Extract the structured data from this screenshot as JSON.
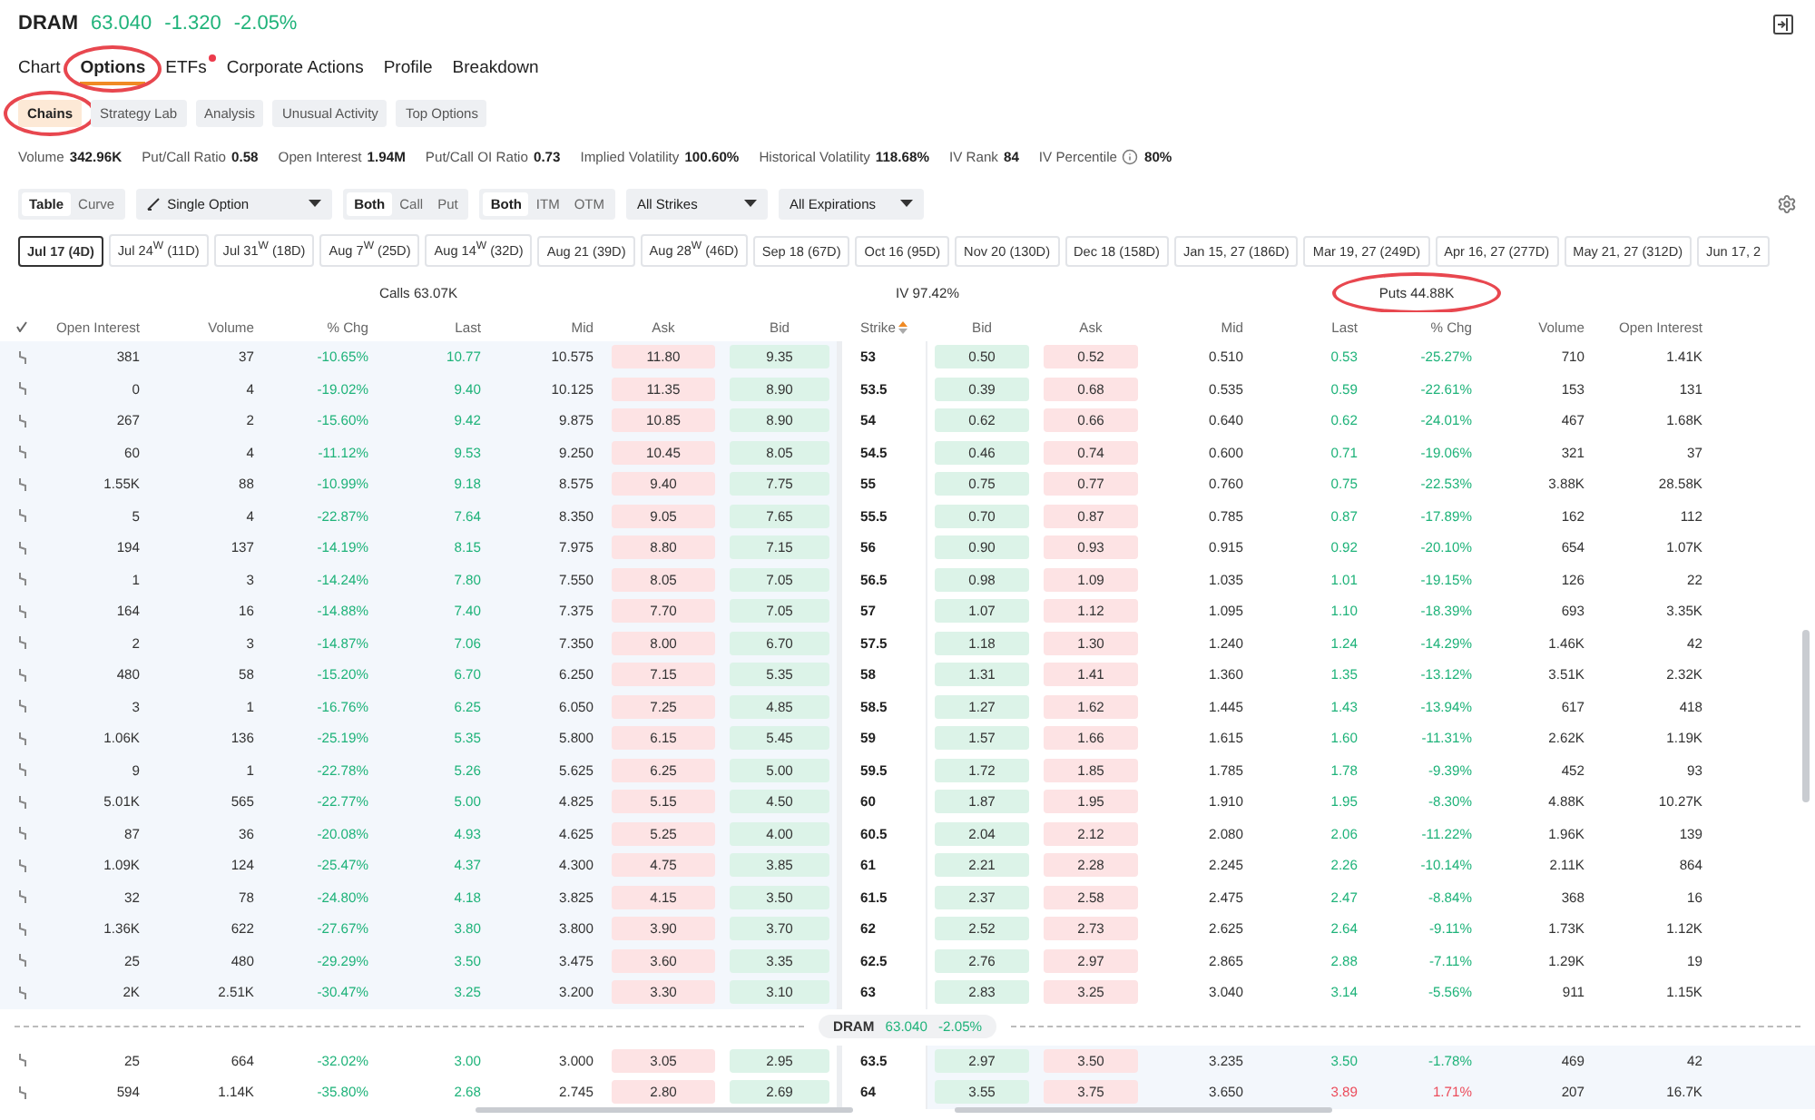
{
  "quote": {
    "symbol": "DRAM",
    "price": "63.040",
    "change": "-1.320",
    "percent": "-2.05%",
    "up": false
  },
  "tabs": [
    {
      "label": "Chart",
      "selected": false
    },
    {
      "label": "Options",
      "selected": true,
      "circled": true
    },
    {
      "label": "ETFs",
      "selected": false,
      "badge": true
    },
    {
      "label": "Corporate Actions",
      "selected": false
    },
    {
      "label": "Profile",
      "selected": false
    },
    {
      "label": "Breakdown",
      "selected": false
    }
  ],
  "subtabs": [
    {
      "label": "Chains",
      "selected": true,
      "circled": true
    },
    {
      "label": "Strategy Lab",
      "selected": false
    },
    {
      "label": "Analysis",
      "selected": false
    },
    {
      "label": "Unusual Activity",
      "selected": false
    },
    {
      "label": "Top Options",
      "selected": false
    }
  ],
  "stats": [
    {
      "label": "Volume",
      "value": "342.96K"
    },
    {
      "label": "Put/Call Ratio",
      "value": "0.58"
    },
    {
      "label": "Open Interest",
      "value": "1.94M"
    },
    {
      "label": "Put/Call OI Ratio",
      "value": "0.73"
    },
    {
      "label": "Implied Volatility",
      "value": "100.60%"
    },
    {
      "label": "Historical Volatility",
      "value": "118.68%"
    },
    {
      "label": "IV Rank",
      "value": "84"
    },
    {
      "label": "IV Percentile",
      "value": "80%",
      "info": true
    }
  ],
  "toolbar": {
    "view": [
      {
        "label": "Table",
        "selected": true
      },
      {
        "label": "Curve",
        "selected": false
      }
    ],
    "strategy": "Single Option",
    "side": [
      {
        "label": "Both",
        "selected": true
      },
      {
        "label": "Call",
        "selected": false
      },
      {
        "label": "Put",
        "selected": false
      }
    ],
    "moneyness": [
      {
        "label": "Both",
        "selected": true
      },
      {
        "label": "ITM",
        "selected": false
      },
      {
        "label": "OTM",
        "selected": false
      }
    ],
    "strikes": "All Strikes",
    "expirations": "All Expirations"
  },
  "expirations": [
    {
      "label": "Jul 17 (4D)",
      "selected": true
    },
    {
      "label": "Jul 24$^{W}$ (11D)",
      "selected": false
    },
    {
      "label": "Jul 31$^{W}$ (18D)",
      "selected": false
    },
    {
      "label": "Aug 7$^{W}$ (25D)",
      "selected": false
    },
    {
      "label": "Aug 14$^{W}$ (32D)",
      "selected": false
    },
    {
      "label": "Aug 21 (39D)",
      "selected": false
    },
    {
      "label": "Aug 28$^{W}$ (46D)",
      "selected": false
    },
    {
      "label": "Sep 18 (67D)",
      "selected": false
    },
    {
      "label": "Oct 16 (95D)",
      "selected": false
    },
    {
      "label": "Nov 20 (130D)",
      "selected": false
    },
    {
      "label": "Dec 18 (158D)",
      "selected": false
    },
    {
      "label": "Jan 15, 27 (186D)",
      "selected": false
    },
    {
      "label": "Mar 19, 27 (249D)",
      "selected": false
    },
    {
      "label": "Apr 16, 27 (277D)",
      "selected": false
    },
    {
      "label": "May 21, 27 (312D)",
      "selected": false
    },
    {
      "label": "Jun 17, 2",
      "selected": false
    }
  ],
  "summary": {
    "calls": "Calls 63.07K",
    "iv": "IV 97.42%",
    "puts": "Puts 44.88K",
    "puts_circled": true
  },
  "table": {
    "call_columns": [
      "Open Interest",
      "Volume",
      "% Chg",
      "Last",
      "Mid",
      "Ask",
      "Bid"
    ],
    "strike_column": "Strike",
    "put_columns": [
      "Bid",
      "Ask",
      "Mid",
      "Last",
      "% Chg",
      "Volume",
      "Open Interest"
    ],
    "rows": [
      {
        "kind": "option",
        "strike": "53",
        "calls_itm": true,
        "puts_itm": false,
        "call_up": false,
        "put_up": false,
        "call": [
          "381",
          "37",
          "-10.65%",
          "10.77",
          "10.575",
          "11.80",
          "9.35"
        ],
        "put": [
          "0.50",
          "0.52",
          "0.510",
          "0.53",
          "-25.27%",
          "710",
          "1.41K"
        ]
      },
      {
        "kind": "option",
        "strike": "53.5",
        "calls_itm": true,
        "puts_itm": false,
        "call_up": false,
        "put_up": false,
        "call": [
          "0",
          "4",
          "-19.02%",
          "9.40",
          "10.125",
          "11.35",
          "8.90"
        ],
        "put": [
          "0.39",
          "0.68",
          "0.535",
          "0.59",
          "-22.61%",
          "153",
          "131"
        ]
      },
      {
        "kind": "option",
        "strike": "54",
        "calls_itm": true,
        "puts_itm": false,
        "call_up": false,
        "put_up": false,
        "call": [
          "267",
          "2",
          "-15.60%",
          "9.42",
          "9.875",
          "10.85",
          "8.90"
        ],
        "put": [
          "0.62",
          "0.66",
          "0.640",
          "0.62",
          "-24.01%",
          "467",
          "1.68K"
        ]
      },
      {
        "kind": "option",
        "strike": "54.5",
        "calls_itm": true,
        "puts_itm": false,
        "call_up": false,
        "put_up": false,
        "call": [
          "60",
          "4",
          "-11.12%",
          "9.53",
          "9.250",
          "10.45",
          "8.05"
        ],
        "put": [
          "0.46",
          "0.74",
          "0.600",
          "0.71",
          "-19.06%",
          "321",
          "37"
        ]
      },
      {
        "kind": "option",
        "strike": "55",
        "calls_itm": true,
        "puts_itm": false,
        "call_up": false,
        "put_up": false,
        "call": [
          "1.55K",
          "88",
          "-10.99%",
          "9.18",
          "8.575",
          "9.40",
          "7.75"
        ],
        "put": [
          "0.75",
          "0.77",
          "0.760",
          "0.75",
          "-22.53%",
          "3.88K",
          "28.58K"
        ]
      },
      {
        "kind": "option",
        "strike": "55.5",
        "calls_itm": true,
        "puts_itm": false,
        "call_up": false,
        "put_up": false,
        "call": [
          "5",
          "4",
          "-22.87%",
          "7.64",
          "8.350",
          "9.05",
          "7.65"
        ],
        "put": [
          "0.70",
          "0.87",
          "0.785",
          "0.87",
          "-17.89%",
          "162",
          "112"
        ]
      },
      {
        "kind": "option",
        "strike": "56",
        "calls_itm": true,
        "puts_itm": false,
        "call_up": false,
        "put_up": false,
        "call": [
          "194",
          "137",
          "-14.19%",
          "8.15",
          "7.975",
          "8.80",
          "7.15"
        ],
        "put": [
          "0.90",
          "0.93",
          "0.915",
          "0.92",
          "-20.10%",
          "654",
          "1.07K"
        ]
      },
      {
        "kind": "option",
        "strike": "56.5",
        "calls_itm": true,
        "puts_itm": false,
        "call_up": false,
        "put_up": false,
        "call": [
          "1",
          "3",
          "-14.24%",
          "7.80",
          "7.550",
          "8.05",
          "7.05"
        ],
        "put": [
          "0.98",
          "1.09",
          "1.035",
          "1.01",
          "-19.15%",
          "126",
          "22"
        ]
      },
      {
        "kind": "option",
        "strike": "57",
        "calls_itm": true,
        "puts_itm": false,
        "call_up": false,
        "put_up": false,
        "call": [
          "164",
          "16",
          "-14.88%",
          "7.40",
          "7.375",
          "7.70",
          "7.05"
        ],
        "put": [
          "1.07",
          "1.12",
          "1.095",
          "1.10",
          "-18.39%",
          "693",
          "3.35K"
        ]
      },
      {
        "kind": "option",
        "strike": "57.5",
        "calls_itm": true,
        "puts_itm": false,
        "call_up": false,
        "put_up": false,
        "call": [
          "2",
          "3",
          "-14.87%",
          "7.06",
          "7.350",
          "8.00",
          "6.70"
        ],
        "put": [
          "1.18",
          "1.30",
          "1.240",
          "1.24",
          "-14.29%",
          "1.46K",
          "42"
        ]
      },
      {
        "kind": "option",
        "strike": "58",
        "calls_itm": true,
        "puts_itm": false,
        "call_up": false,
        "put_up": false,
        "call": [
          "480",
          "58",
          "-15.20%",
          "6.70",
          "6.250",
          "7.15",
          "5.35"
        ],
        "put": [
          "1.31",
          "1.41",
          "1.360",
          "1.35",
          "-13.12%",
          "3.51K",
          "2.32K"
        ]
      },
      {
        "kind": "option",
        "strike": "58.5",
        "calls_itm": true,
        "puts_itm": false,
        "call_up": false,
        "put_up": false,
        "call": [
          "3",
          "1",
          "-16.76%",
          "6.25",
          "6.050",
          "7.25",
          "4.85"
        ],
        "put": [
          "1.27",
          "1.62",
          "1.445",
          "1.43",
          "-13.94%",
          "617",
          "418"
        ]
      },
      {
        "kind": "option",
        "strike": "59",
        "calls_itm": true,
        "puts_itm": false,
        "call_up": false,
        "put_up": false,
        "call": [
          "1.06K",
          "136",
          "-25.19%",
          "5.35",
          "5.800",
          "6.15",
          "5.45"
        ],
        "put": [
          "1.57",
          "1.66",
          "1.615",
          "1.60",
          "-11.31%",
          "2.62K",
          "1.19K"
        ]
      },
      {
        "kind": "option",
        "strike": "59.5",
        "calls_itm": true,
        "puts_itm": false,
        "call_up": false,
        "put_up": false,
        "call": [
          "9",
          "1",
          "-22.78%",
          "5.26",
          "5.625",
          "6.25",
          "5.00"
        ],
        "put": [
          "1.72",
          "1.85",
          "1.785",
          "1.78",
          "-9.39%",
          "452",
          "93"
        ]
      },
      {
        "kind": "option",
        "strike": "60",
        "calls_itm": true,
        "puts_itm": false,
        "call_up": false,
        "put_up": false,
        "call": [
          "5.01K",
          "565",
          "-22.77%",
          "5.00",
          "4.825",
          "5.15",
          "4.50"
        ],
        "put": [
          "1.87",
          "1.95",
          "1.910",
          "1.95",
          "-8.30%",
          "4.88K",
          "10.27K"
        ]
      },
      {
        "kind": "option",
        "strike": "60.5",
        "calls_itm": true,
        "puts_itm": false,
        "call_up": false,
        "put_up": false,
        "call": [
          "87",
          "36",
          "-20.08%",
          "4.93",
          "4.625",
          "5.25",
          "4.00"
        ],
        "put": [
          "2.04",
          "2.12",
          "2.080",
          "2.06",
          "-11.22%",
          "1.96K",
          "139"
        ]
      },
      {
        "kind": "option",
        "strike": "61",
        "calls_itm": true,
        "puts_itm": false,
        "call_up": false,
        "put_up": false,
        "call": [
          "1.09K",
          "124",
          "-25.47%",
          "4.37",
          "4.300",
          "4.75",
          "3.85"
        ],
        "put": [
          "2.21",
          "2.28",
          "2.245",
          "2.26",
          "-10.14%",
          "2.11K",
          "864"
        ]
      },
      {
        "kind": "option",
        "strike": "61.5",
        "calls_itm": true,
        "puts_itm": false,
        "call_up": false,
        "put_up": false,
        "call": [
          "32",
          "78",
          "-24.80%",
          "4.18",
          "3.825",
          "4.15",
          "3.50"
        ],
        "put": [
          "2.37",
          "2.58",
          "2.475",
          "2.47",
          "-8.84%",
          "368",
          "16"
        ]
      },
      {
        "kind": "option",
        "strike": "62",
        "calls_itm": true,
        "puts_itm": false,
        "call_up": false,
        "put_up": false,
        "call": [
          "1.36K",
          "622",
          "-27.67%",
          "3.80",
          "3.800",
          "3.90",
          "3.70"
        ],
        "put": [
          "2.52",
          "2.73",
          "2.625",
          "2.64",
          "-9.11%",
          "1.73K",
          "1.12K"
        ]
      },
      {
        "kind": "option",
        "strike": "62.5",
        "calls_itm": true,
        "puts_itm": false,
        "call_up": false,
        "put_up": false,
        "call": [
          "25",
          "480",
          "-29.29%",
          "3.50",
          "3.475",
          "3.60",
          "3.35"
        ],
        "put": [
          "2.76",
          "2.97",
          "2.865",
          "2.88",
          "-7.11%",
          "1.29K",
          "19"
        ]
      },
      {
        "kind": "option",
        "strike": "63",
        "calls_itm": true,
        "puts_itm": false,
        "call_up": false,
        "put_up": false,
        "call": [
          "2K",
          "2.51K",
          "-30.47%",
          "3.25",
          "3.200",
          "3.30",
          "3.10"
        ],
        "put": [
          "2.83",
          "3.25",
          "3.040",
          "3.14",
          "-5.56%",
          "911",
          "1.15K"
        ]
      },
      {
        "kind": "price",
        "symbol": "DRAM",
        "price": "63.040",
        "percent": "-2.05%",
        "up": false
      },
      {
        "kind": "option",
        "strike": "63.5",
        "calls_itm": false,
        "puts_itm": true,
        "call_up": false,
        "put_up": false,
        "call": [
          "25",
          "664",
          "-32.02%",
          "3.00",
          "3.000",
          "3.05",
          "2.95"
        ],
        "put": [
          "2.97",
          "3.50",
          "3.235",
          "3.50",
          "-1.78%",
          "469",
          "42"
        ]
      },
      {
        "kind": "option",
        "strike": "64",
        "calls_itm": false,
        "puts_itm": true,
        "call_up": false,
        "put_up": true,
        "call": [
          "594",
          "1.14K",
          "-35.80%",
          "2.68",
          "2.745",
          "2.80",
          "2.69"
        ],
        "put": [
          "3.55",
          "3.75",
          "3.650",
          "3.89",
          "1.71%",
          "207",
          "16.7K"
        ]
      }
    ]
  }
}
